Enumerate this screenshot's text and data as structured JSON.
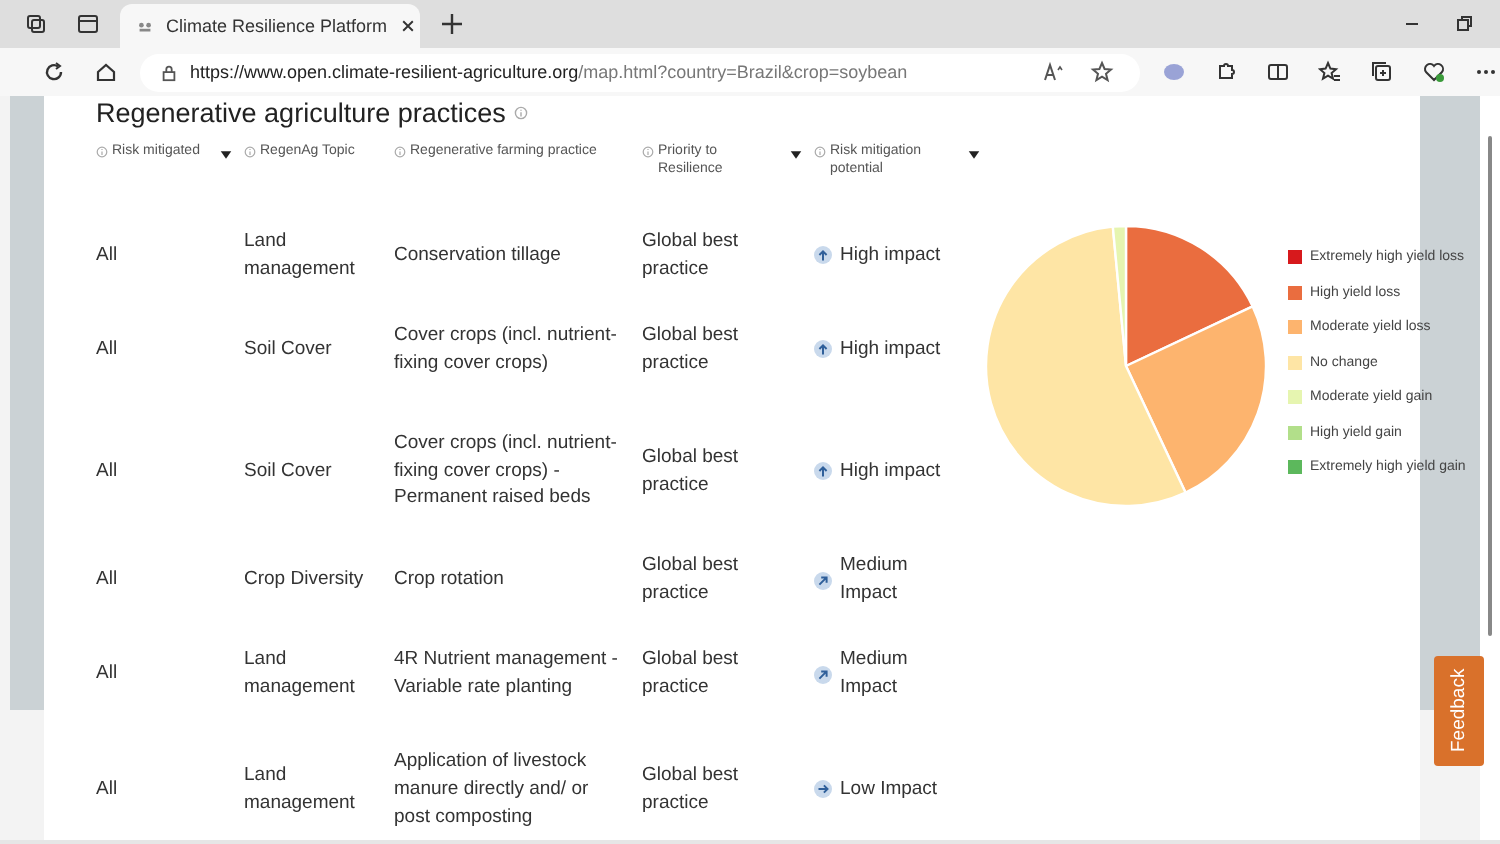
{
  "browser": {
    "tab_title": "Climate Resilience Platform",
    "url_host": "https://www.open.climate-resilient-agriculture.org",
    "url_path": "/map.html?country=Brazil&crop=soybean"
  },
  "section": {
    "title": "Regenerative agriculture practices"
  },
  "table": {
    "columns": [
      {
        "label": "Risk mitigated",
        "filter": true
      },
      {
        "label": "RegenAg Topic",
        "filter": false
      },
      {
        "label": "Regenerative farming practice",
        "filter": false
      },
      {
        "label": "Priority to Resilience",
        "filter": true
      },
      {
        "label": "Risk mitigation potential",
        "filter": true
      }
    ],
    "rows": [
      {
        "risk": "All",
        "topic": "Land management",
        "practice": "Conservation tillage",
        "priority": "Global best practice",
        "potential": "High impact",
        "kind": "high"
      },
      {
        "risk": "All",
        "topic": "Soil Cover",
        "practice": "Cover crops (incl. nutrient-fixing cover crops)",
        "priority": "Global best practice",
        "potential": "High impact",
        "kind": "high"
      },
      {
        "risk": "All",
        "topic": "Soil Cover",
        "practice": "Cover crops (incl. nutrient-fixing cover crops) - Permanent raised beds",
        "priority": "Global best practice",
        "potential": "High impact",
        "kind": "high"
      },
      {
        "risk": "All",
        "topic": "Crop Diversity",
        "practice": "Crop rotation",
        "priority": "Global best practice",
        "potential": "Medium Impact",
        "kind": "medium"
      },
      {
        "risk": "All",
        "topic": "Land management",
        "practice": "4R Nutrient management - Variable rate planting",
        "priority": "Global best practice",
        "potential": "Medium Impact",
        "kind": "medium"
      },
      {
        "risk": "All",
        "topic": "Land management",
        "practice": "Application of livestock manure directly and/ or post composting",
        "priority": "Global best practice",
        "potential": "Low Impact",
        "kind": "low"
      }
    ]
  },
  "legend": [
    {
      "label": "Extremely high yield loss",
      "color": "#d7191c"
    },
    {
      "label": "High yield loss",
      "color": "#ea6d3f"
    },
    {
      "label": "Moderate yield loss",
      "color": "#fdb46e"
    },
    {
      "label": "No change",
      "color": "#fee5a5"
    },
    {
      "label": "Moderate yield gain",
      "color": "#e6f5b0"
    },
    {
      "label": "High yield gain",
      "color": "#b2df8a"
    },
    {
      "label": "Extremely high yield gain",
      "color": "#5cb85c"
    }
  ],
  "feedback": {
    "label": "Feedback"
  }
}
